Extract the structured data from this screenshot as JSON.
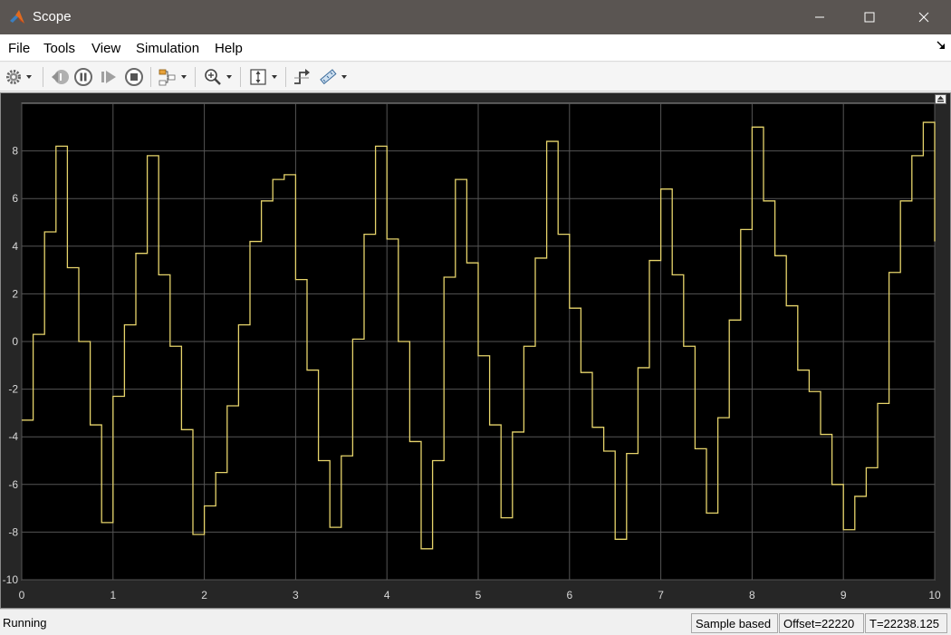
{
  "window": {
    "title": "Scope"
  },
  "menu": {
    "items": [
      "File",
      "Tools",
      "View",
      "Simulation",
      "Help"
    ]
  },
  "status": {
    "state": "Running",
    "mode": "Sample based",
    "offset": "Offset=22220",
    "time": "T=22238.125"
  },
  "colors": {
    "title_bar": "#5a5552",
    "plot_background": "#000000",
    "figure_background": "#262626",
    "signal": "#e6d46b",
    "grid": "#555555",
    "tick_labels": "#d8d8d8"
  },
  "chart_data": {
    "type": "line",
    "step": true,
    "x": [
      0,
      0.125,
      0.25,
      0.375,
      0.5,
      0.625,
      0.75,
      0.875,
      1.0,
      1.125,
      1.25,
      1.375,
      1.5,
      1.625,
      1.75,
      1.875,
      2.0,
      2.125,
      2.25,
      2.375,
      2.5,
      2.625,
      2.75,
      2.875,
      3.0,
      3.125,
      3.25,
      3.375,
      3.5,
      3.625,
      3.75,
      3.875,
      4.0,
      4.125,
      4.25,
      4.375,
      4.5,
      4.625,
      4.75,
      4.875,
      5.0,
      5.125,
      5.25,
      5.375,
      5.5,
      5.625,
      5.75,
      5.875,
      6.0,
      6.125,
      6.25,
      6.375,
      6.5,
      6.625,
      6.75,
      6.875,
      7.0,
      7.125,
      7.25,
      7.375,
      7.5,
      7.625,
      7.75,
      7.875,
      8.0,
      8.125,
      8.25,
      8.375,
      8.5,
      8.625,
      8.75,
      8.875,
      9.0,
      9.125,
      9.25,
      9.375,
      9.5,
      9.625,
      9.75,
      9.875,
      10.0
    ],
    "y": [
      -3.3,
      0.3,
      4.6,
      8.2,
      3.1,
      0.0,
      -3.5,
      -7.6,
      -2.3,
      0.7,
      3.7,
      7.8,
      2.8,
      -0.2,
      -3.7,
      -8.1,
      -6.9,
      -5.5,
      -2.7,
      0.7,
      4.2,
      5.9,
      6.8,
      7.0,
      2.6,
      -1.2,
      -5.0,
      -7.8,
      -4.8,
      0.1,
      4.5,
      8.2,
      4.3,
      0.0,
      -4.2,
      -8.7,
      -5.0,
      2.7,
      6.8,
      3.3,
      -0.6,
      -3.5,
      -7.4,
      -3.8,
      -0.2,
      3.5,
      8.4,
      4.5,
      1.4,
      -1.3,
      -3.6,
      -4.6,
      -8.3,
      -4.7,
      -1.1,
      3.4,
      6.4,
      2.8,
      -0.2,
      -4.5,
      -7.2,
      -3.2,
      0.9,
      4.7,
      9.0,
      5.9,
      3.6,
      1.5,
      -1.2,
      -2.1,
      -3.9,
      -6.0,
      -7.9,
      -6.5,
      -5.3,
      -2.6,
      2.9,
      5.9,
      7.8,
      9.2,
      4.2
    ],
    "xlim": [
      0,
      10
    ],
    "ylim": [
      -10,
      10
    ],
    "x_ticks": [
      0,
      1,
      2,
      3,
      4,
      5,
      6,
      7,
      8,
      9,
      10
    ],
    "y_ticks": [
      -10,
      -8,
      -6,
      -4,
      -2,
      0,
      2,
      4,
      6,
      8
    ],
    "grid": true,
    "legend": "none"
  }
}
